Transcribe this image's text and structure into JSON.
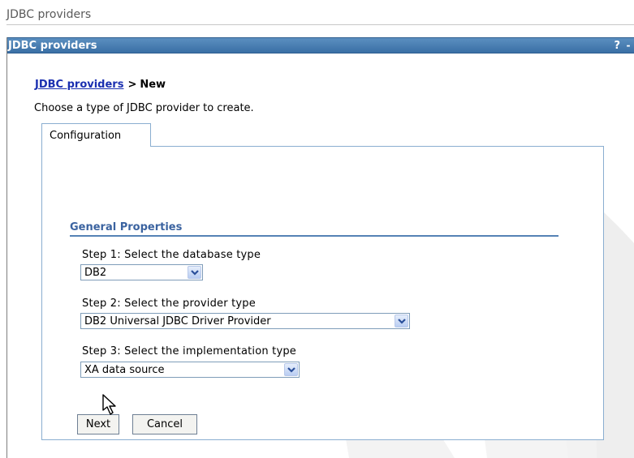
{
  "page": {
    "title": "JDBC providers"
  },
  "portlet": {
    "title": "JDBC providers",
    "help_label": "?",
    "minimize_label": "-"
  },
  "breadcrumb": {
    "link": "JDBC providers",
    "separator": ">",
    "current": "New"
  },
  "instruction": "Choose a type of JDBC provider to create.",
  "tabs": [
    {
      "label": "Configuration"
    }
  ],
  "section": {
    "title": "General Properties"
  },
  "steps": [
    {
      "label": "Step 1: Select the database type",
      "value": "DB2"
    },
    {
      "label": "Step 2: Select the provider type",
      "value": "DB2 Universal JDBC Driver Provider"
    },
    {
      "label": "Step 3: Select the implementation type",
      "value": "XA data source"
    }
  ],
  "buttons": {
    "next": "Next",
    "cancel": "Cancel"
  },
  "colors": {
    "header_bg": "#3a6fa5",
    "link": "#1a2fb0",
    "section": "#3b63a0",
    "tab_border": "#8aaed0"
  }
}
